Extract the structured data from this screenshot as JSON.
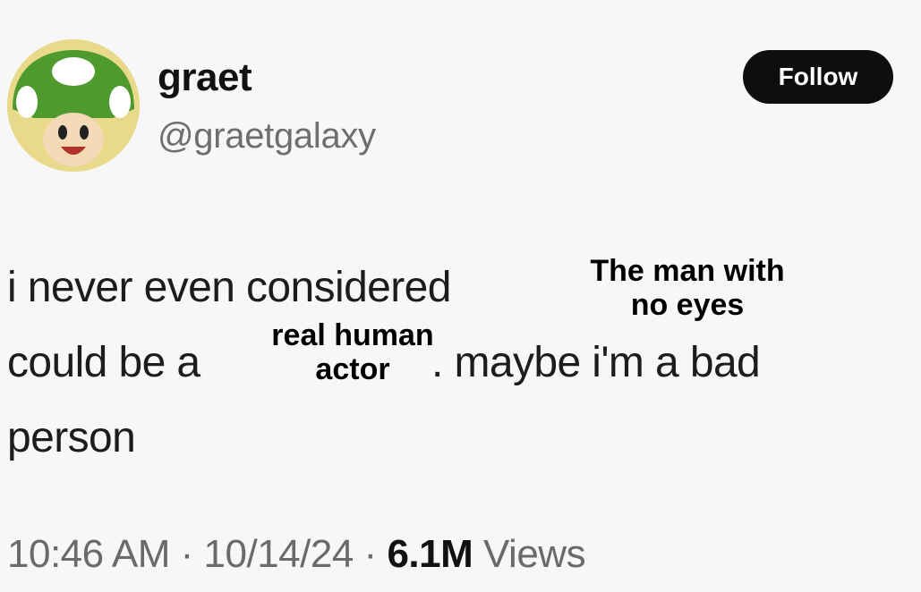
{
  "profile": {
    "display_name": "graet",
    "handle": "@graetgalaxy",
    "avatar_icon": "green-mushroom-toad-avatar-icon"
  },
  "follow_button": {
    "label": "Follow"
  },
  "tweet": {
    "line1": "i never even considered",
    "line2_before": "could be a",
    "line2_after": ". maybe i'm a bad",
    "line3": "person"
  },
  "overlays": {
    "top_line1": "The man with",
    "top_line2": "no eyes",
    "middle_line1": "real human",
    "middle_line2": "actor"
  },
  "meta": {
    "time": "10:46 AM",
    "separator": "·",
    "date": "10/14/24",
    "views_count": "6.1M",
    "views_label": "Views"
  },
  "colors": {
    "background": "#f7f7f7",
    "button": "#0e0e0e",
    "muted_text": "#6e6e6e",
    "avatar_cap": "#4f9a2e"
  }
}
